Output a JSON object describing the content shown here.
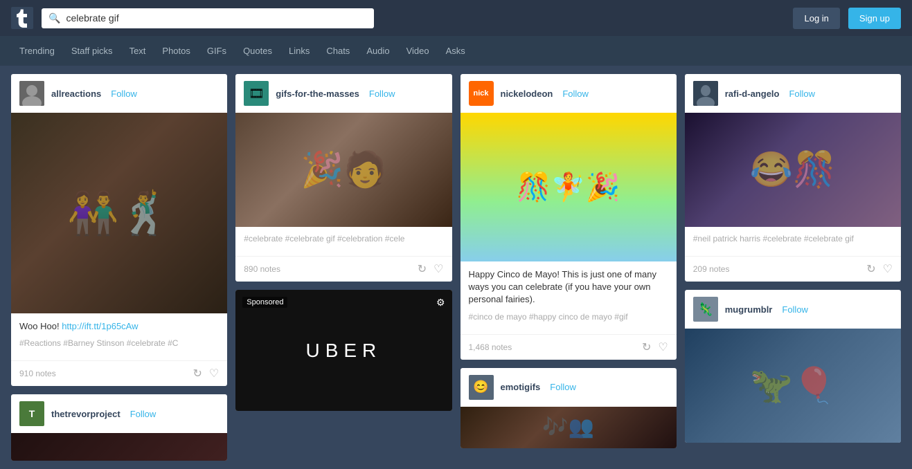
{
  "header": {
    "logo_symbol": "t",
    "search_value": "celebrate gif",
    "search_placeholder": "Search",
    "login_label": "Log in",
    "signup_label": "Sign up"
  },
  "nav": {
    "items": [
      {
        "label": "Trending",
        "active": false
      },
      {
        "label": "Staff picks",
        "active": false
      },
      {
        "label": "Text",
        "active": false
      },
      {
        "label": "Photos",
        "active": false
      },
      {
        "label": "GIFs",
        "active": false
      },
      {
        "label": "Quotes",
        "active": false
      },
      {
        "label": "Links",
        "active": false
      },
      {
        "label": "Chats",
        "active": false
      },
      {
        "label": "Audio",
        "active": false
      },
      {
        "label": "Video",
        "active": false
      },
      {
        "label": "Asks",
        "active": false
      }
    ]
  },
  "cards": {
    "col1": [
      {
        "id": "allreactions",
        "username": "allreactions",
        "follow_label": "Follow",
        "has_image": true,
        "image_type": "allreactions",
        "text": "Woo Hoo! http://ift.tt/1p65cAw",
        "link_text": "http://ift.tt/1p65cAw",
        "tags": "#Reactions  #Barney Stinson  #celebrate  #C",
        "notes": "910 notes"
      },
      {
        "id": "thetrevorproject",
        "username": "thetrevorproject",
        "follow_label": "Follow",
        "has_image": false,
        "image_type": "thetrevor",
        "notes": ""
      }
    ],
    "col2": [
      {
        "id": "gifs-for-the-masses",
        "username": "gifs-for-the-masses",
        "follow_label": "Follow",
        "has_image": true,
        "image_type": "gifs",
        "tags": "#celebrate  #celebrate gif  #celebration  #cele",
        "notes": "890 notes"
      },
      {
        "id": "sponsored",
        "is_sponsored": true,
        "badge": "Sponsored",
        "image_type": "uber",
        "uber_text": "UBER"
      }
    ],
    "col3": [
      {
        "id": "nickelodeon",
        "username": "nickelodeon",
        "follow_label": "Follow",
        "has_image": true,
        "image_type": "nickelodeon",
        "text": "Happy Cinco de Mayo! This is just one of many ways you can celebrate (if you have your own personal fairies).",
        "tags": "#cinco de mayo  #happy cinco de mayo  #gif",
        "notes": "1,468 notes"
      },
      {
        "id": "emotigifs",
        "username": "emotigifs",
        "follow_label": "Follow",
        "has_image": true,
        "image_type": "emotigifs",
        "notes": ""
      }
    ],
    "col4": [
      {
        "id": "rafi-d-angelo",
        "username": "rafi-d-angelo",
        "follow_label": "Follow",
        "has_image": true,
        "image_type": "rafi",
        "tags": "#neil patrick harris  #celebrate  #celebrate gif",
        "notes": "209 notes"
      },
      {
        "id": "mugrumblr",
        "username": "mugrumblr",
        "follow_label": "Follow",
        "has_image": true,
        "image_type": "mugrumblr",
        "notes": ""
      }
    ]
  }
}
